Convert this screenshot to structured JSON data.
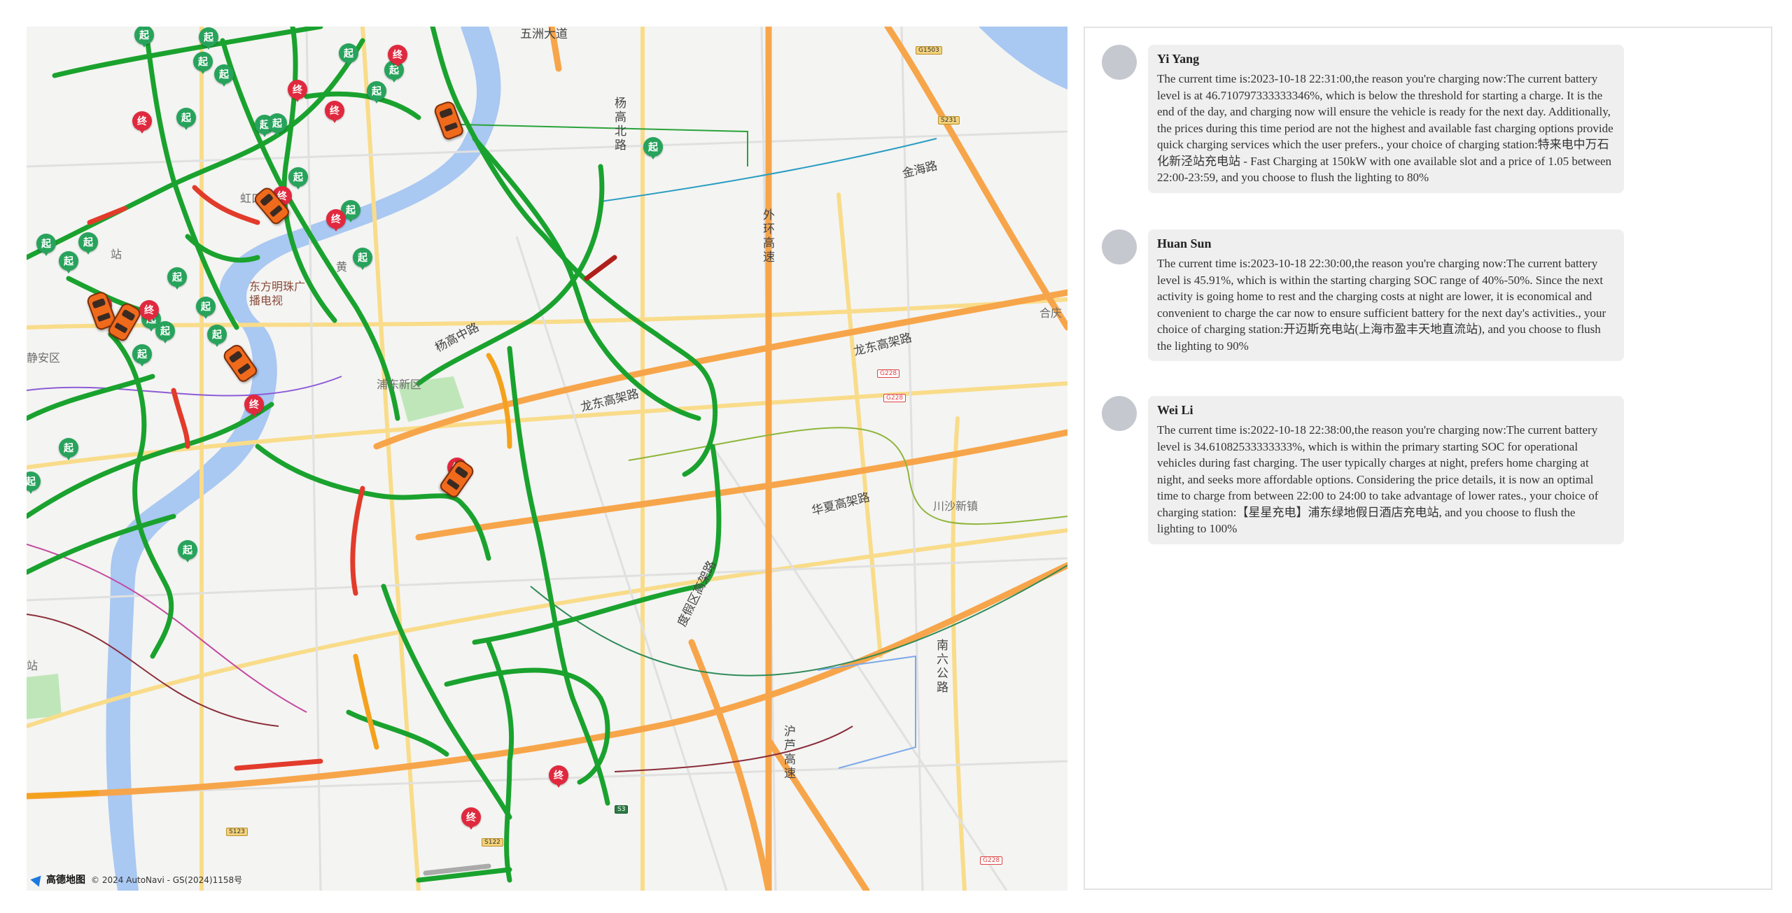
{
  "map": {
    "attribution": {
      "logo_text": "高德地图",
      "copyright": "© 2024 AutoNavi - GS(2024)1158号"
    },
    "labels": [
      {
        "id": "wuzhou",
        "text": "五洲大道"
      },
      {
        "id": "yanggao-north",
        "text": "杨高北路"
      },
      {
        "id": "jinhai",
        "text": "金海路"
      },
      {
        "id": "waihuan",
        "text": "外环高速"
      },
      {
        "id": "hongkou",
        "text": "虹口"
      },
      {
        "id": "huangpu",
        "text": "黄"
      },
      {
        "id": "oriental-pearl",
        "text": "东方明珠广播电视"
      },
      {
        "id": "jingan",
        "text": "静安区"
      },
      {
        "id": "yanggao-middle",
        "text": "杨高中路"
      },
      {
        "id": "pudong-new",
        "text": "浦东新区"
      },
      {
        "id": "longdong-1",
        "text": "龙东高架路"
      },
      {
        "id": "longdong-2",
        "text": "龙东高架路"
      },
      {
        "id": "heqing",
        "text": "合庆"
      },
      {
        "id": "huaxia",
        "text": "华夏高架路"
      },
      {
        "id": "chuansha",
        "text": "川沙新镇"
      },
      {
        "id": "dujiaqu",
        "text": "度假区高架路"
      },
      {
        "id": "nanliu",
        "text": "南六公路"
      },
      {
        "id": "hulu",
        "text": "沪芦高速"
      },
      {
        "id": "station-top",
        "text": "站"
      },
      {
        "id": "station-left",
        "text": "站"
      }
    ],
    "markers": {
      "start_label": "起",
      "end_label": "终"
    },
    "shields": [
      "G1503",
      "S231",
      "G228",
      "G228",
      "S3",
      "S122",
      "S123",
      "G228"
    ]
  },
  "colors": {
    "route_green": "#1aa22e",
    "congestion_red": "#e23b2b",
    "slow_yellow": "#f4a21d",
    "river_blue": "#a9c8f2",
    "expressway_orange": "#f7a54a",
    "start_marker": "#27a35c",
    "end_marker": "#e0293e"
  },
  "messages": [
    {
      "name": "Yi Yang",
      "text": "The current time is:2023-10-18 22:31:00,the reason you're charging now:The current battery level is at 46.710797333333346%, which is below the threshold for starting a charge. It is the end of the day, and charging now will ensure the vehicle is ready for the next day. Additionally, the prices during this time period are not the highest and available fast charging options provide quick charging services which the user prefers., your choice of charging station:特来电中万石化新泾站充电站 - Fast Charging at 150kW with one available slot and a price of 1.05 between 22:00-23:59, and you choose to flush the lighting to 80%"
    },
    {
      "name": "Huan Sun",
      "text": "The current time is:2023-10-18 22:30:00,the reason you're charging now:The current battery level is 45.91%, which is within the starting charging SOC range of 40%-50%. Since the next activity is going home to rest and the charging costs at night are lower, it is economical and convenient to charge the car now to ensure sufficient battery for the next day's activities., your choice of charging station:开迈斯充电站(上海市盈丰天地直流站), and you choose to flush the lighting to 90%"
    },
    {
      "name": "Wei Li",
      "text": "The current time is:2022-10-18 22:38:00,the reason you're charging now:The current battery level is 34.61082533333333%, which is within the primary starting SOC for operational vehicles during fast charging. The user typically charges at night, prefers home charging at night, and seeks more affordable options. Considering the price details, it is now an optimal time to charge from between 22:00 to 24:00 to take advantage of lower rates., your choice of charging station:【星星充电】浦东绿地假日酒店充电站, and you choose to flush the lighting to 100%"
    }
  ]
}
